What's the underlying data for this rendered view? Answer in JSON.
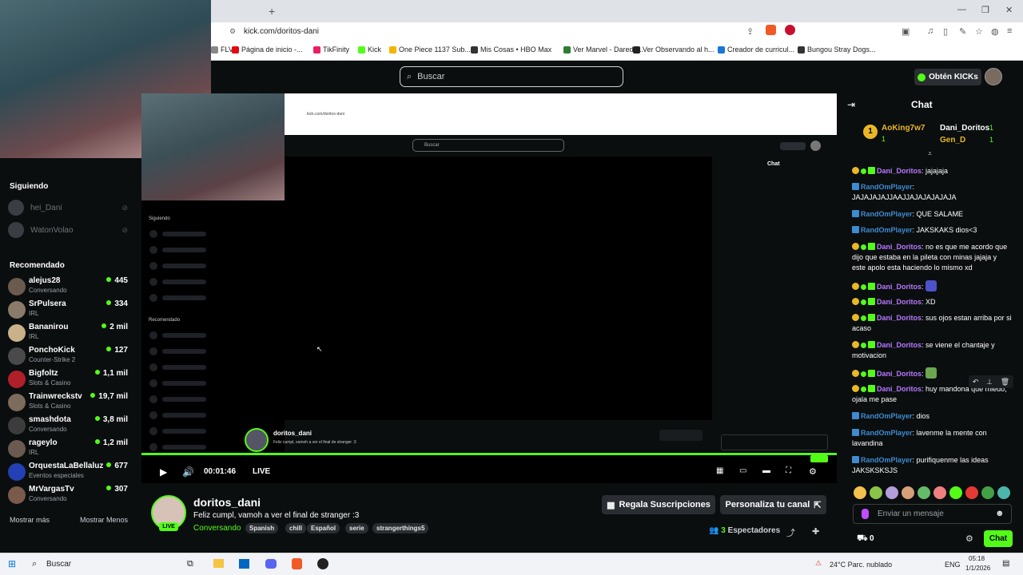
{
  "browser": {
    "new_tab": "+",
    "url": "kick.com/doritos-dani",
    "bookmarks": [
      {
        "label": "FLV",
        "color": "#888"
      },
      {
        "label": "Página de inicio -...",
        "color": "#e50914"
      },
      {
        "label": "TikFinity",
        "color": "#e91e63"
      },
      {
        "label": "Kick",
        "color": "#53fc18"
      },
      {
        "label": "One Piece 1137 Sub...",
        "color": "#f4b400"
      },
      {
        "label": "Mis Cosas • HBO Max",
        "color": "#333"
      },
      {
        "label": "Ver Marvel - Darede...",
        "color": "#2e7d32"
      },
      {
        "label": "Ver Observando al h...",
        "color": "#222"
      },
      {
        "label": "Creador de curricul...",
        "color": "#1976d2"
      },
      {
        "label": "Bungou Stray Dogs...",
        "color": "#333"
      }
    ]
  },
  "header": {
    "search_placeholder": "Buscar",
    "kicks_label": "Obtén KICKs"
  },
  "sidebar": {
    "following_title": "Siguiendo",
    "following": [
      {
        "name": "hei_Dani"
      },
      {
        "name": "WatonVolao"
      }
    ],
    "recommended_title": "Recomendado",
    "recommended": [
      {
        "name": "alejus28",
        "category": "Conversando",
        "viewers": "445",
        "color": "#6b5b4e"
      },
      {
        "name": "SrPulsera",
        "category": "IRL",
        "viewers": "334",
        "color": "#8a7a6a"
      },
      {
        "name": "Bananirou",
        "category": "IRL",
        "viewers": "2 mil",
        "color": "#c9b18a"
      },
      {
        "name": "PonchoKick",
        "category": "Counter-Strike 2",
        "viewers": "127",
        "color": "#4a4a4a"
      },
      {
        "name": "Bigfoltz",
        "category": "Slots & Casino",
        "viewers": "1,1 mil",
        "color": "#b0202a"
      },
      {
        "name": "Trainwreckstv",
        "category": "Slots & Casino",
        "viewers": "19,7 mil",
        "color": "#7d6b5c"
      },
      {
        "name": "smashdota",
        "category": "Conversando",
        "viewers": "3,8 mil",
        "color": "#3c3c3c"
      },
      {
        "name": "rageylo",
        "category": "IRL",
        "viewers": "1,2 mil",
        "color": "#6a5a50"
      },
      {
        "name": "OrquestaLaBellaluz",
        "category": "Eventos especiales",
        "viewers": "677",
        "color": "#2340b5"
      },
      {
        "name": "MrVargasTv",
        "category": "Conversando",
        "viewers": "307",
        "color": "#7a5a4a"
      }
    ],
    "show_more": "Mostrar más",
    "show_less": "Mostrar Menos"
  },
  "player": {
    "time": "00:01:46",
    "live": "LIVE"
  },
  "nested": {
    "url": "kick.com/doritos-dani",
    "search": "Buscar",
    "following": "Siguiendo",
    "recommended": "Recomendado",
    "chat": "Chat",
    "streamer": "doritos_dani",
    "title": "Feliz cumpl, vamoh a ver el final de stranger :3"
  },
  "stream": {
    "name": "doritos_dani",
    "live_badge": "LIVE",
    "title": "Feliz cumpl, vamoh a ver el final de stranger :3",
    "category": "Conversando",
    "tags": [
      "Spanish",
      "chill",
      "Español",
      "serie",
      "strangerthings5"
    ],
    "subs_button": "Regala Suscripciones",
    "customize_button": "Personaliza tu canal",
    "viewers_count": "3",
    "viewers_label": "Espectadores"
  },
  "chat": {
    "title": "Chat",
    "gifters": [
      {
        "name": "AoKing7w7",
        "count": "1"
      },
      {
        "name": "Dani_Doritos",
        "count": "1"
      },
      {
        "name": "Gen_D",
        "count": "1"
      }
    ],
    "messages": [
      {
        "user": "Dani_Doritos",
        "text": "jajajaja",
        "color": "#b679ff",
        "badges": "gold"
      },
      {
        "user": "RandOmPlayer",
        "text": "JAJAJAJAJJAAJJAJAJAJAJAJA",
        "color": "#3f8bd0",
        "badges": "blue"
      },
      {
        "user": "RandOmPlayer",
        "text": "QUE SALAME",
        "color": "#3f8bd0",
        "badges": "blue"
      },
      {
        "user": "RandOmPlayer",
        "text": "JAKSKAKS dios<3",
        "color": "#3f8bd0",
        "badges": "blue"
      },
      {
        "user": "Dani_Doritos",
        "text": "no es que me acordo que dijo que estaba en la pileta con minas jajaja y este apolo esta haciendo lo mismo xd",
        "color": "#b679ff",
        "badges": "gold"
      },
      {
        "user": "Dani_Doritos",
        "text": "",
        "color": "#b679ff",
        "badges": "gold"
      },
      {
        "user": "Dani_Doritos",
        "text": "XD",
        "color": "#b679ff",
        "badges": "gold"
      },
      {
        "user": "Dani_Doritos",
        "text": "sus ojos estan arriba por si acaso",
        "color": "#b679ff",
        "badges": "gold"
      },
      {
        "user": "Dani_Doritos",
        "text": "se viene el chantaje y motivacion",
        "color": "#b679ff",
        "badges": "gold"
      },
      {
        "user": "Dani_Doritos",
        "text": "",
        "color": "#b679ff",
        "badges": "gold"
      },
      {
        "user": "Dani_Doritos",
        "text": "huy mandona que miedo, ojala me pase",
        "color": "#b679ff",
        "badges": "gold"
      },
      {
        "user": "RandOmPlayer",
        "text": "dios",
        "color": "#3f8bd0",
        "badges": "blue"
      },
      {
        "user": "RandOmPlayer",
        "text": "lavenme la mente con lavandina",
        "color": "#3f8bd0",
        "badges": "blue"
      },
      {
        "user": "RandOmPlayer",
        "text": "purifiquenme las ideas JAKSKSKSJS",
        "color": "#3f8bd0",
        "badges": "blue"
      }
    ],
    "input_placeholder": "Enviar un mensaje",
    "points": "0",
    "send_button": "Chat"
  },
  "taskbar": {
    "search": "Buscar",
    "weather": "24°C  Parc. nublado",
    "lang": "ENG",
    "time": "05:18",
    "date": "1/1/2026"
  }
}
